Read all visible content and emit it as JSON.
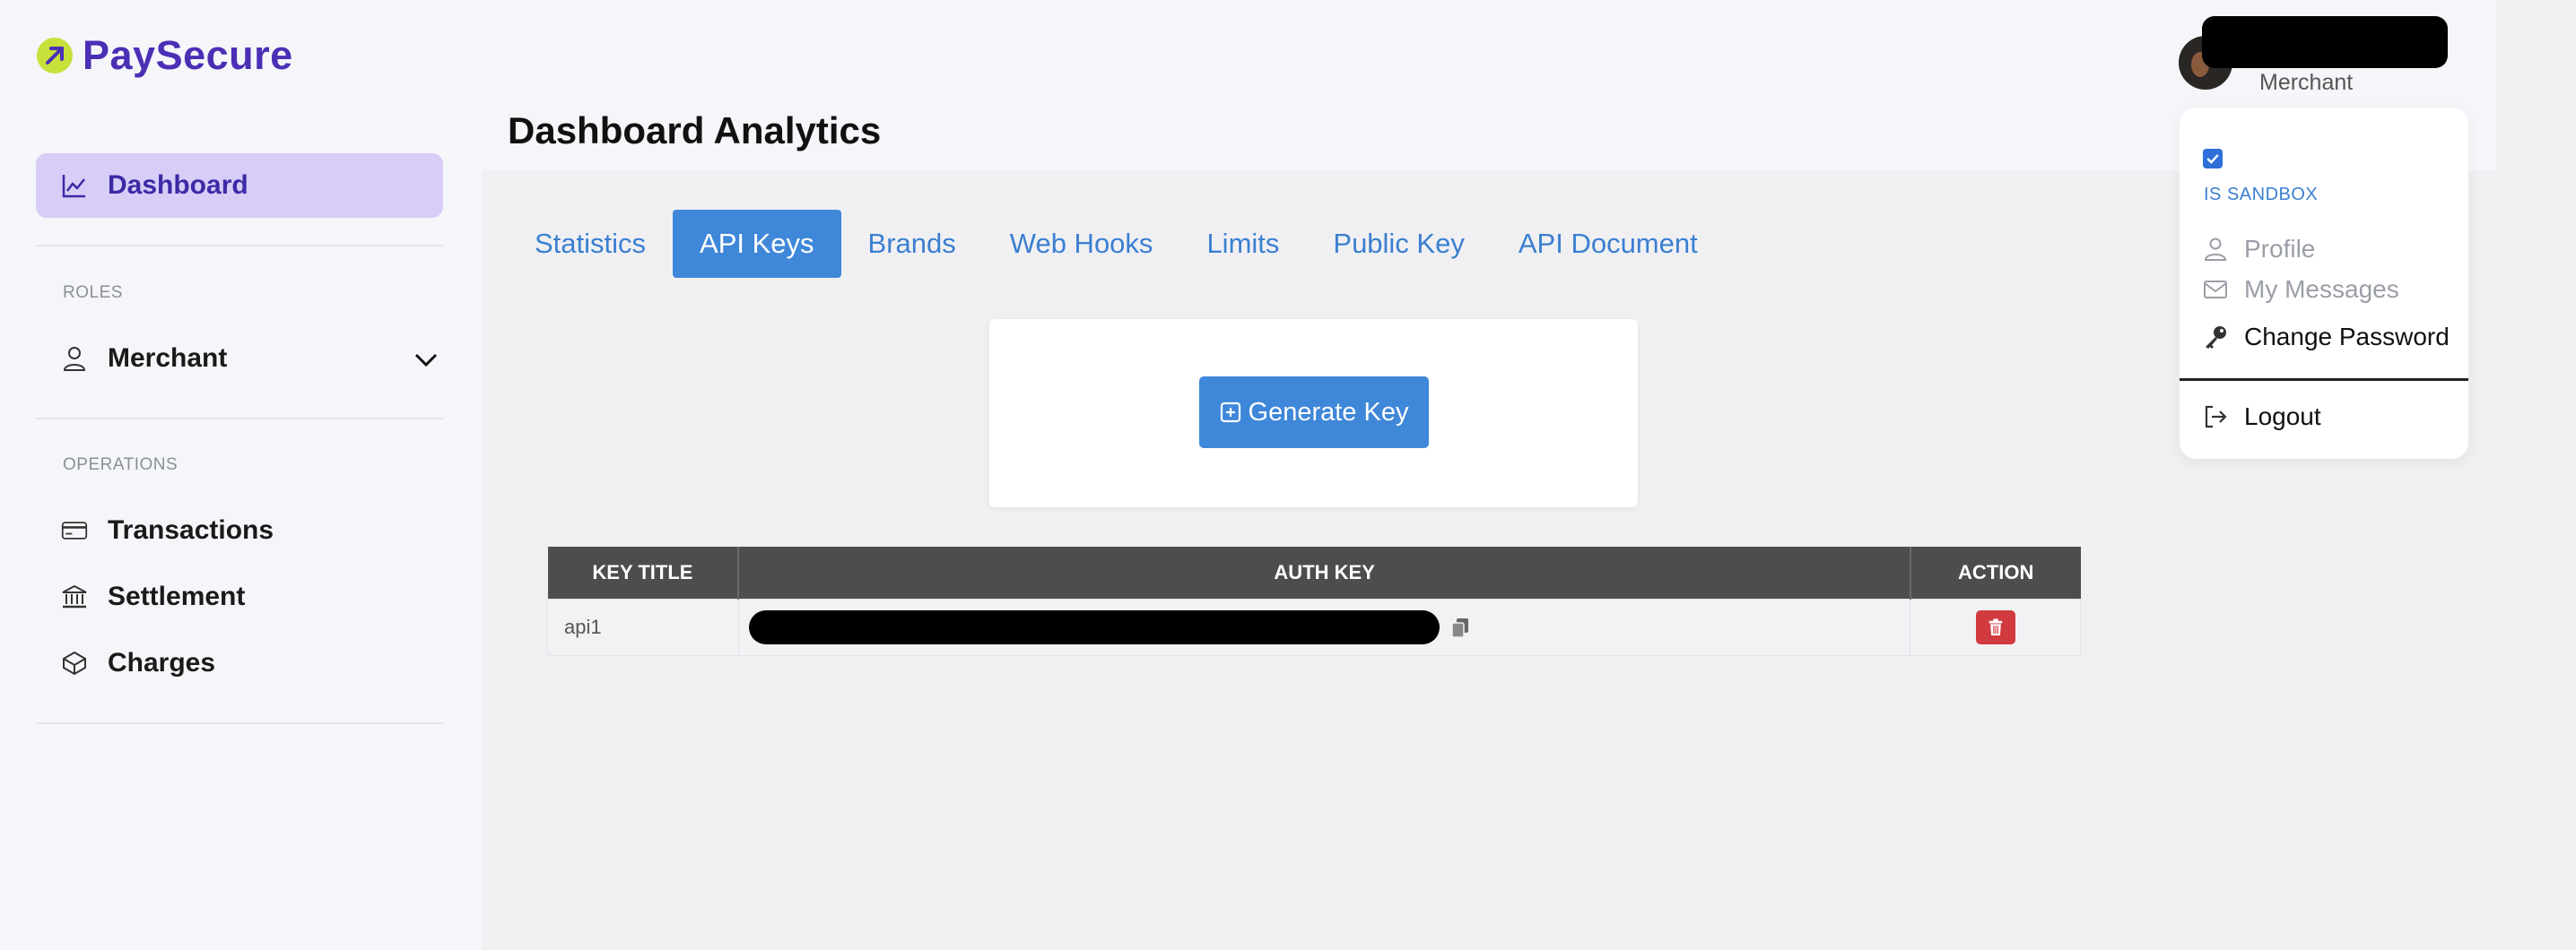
{
  "brand": {
    "name": "PaySecure",
    "colors": {
      "primary": "#4b2fb5",
      "accent": "#c8e03a",
      "button": "#3f87d9",
      "danger": "#d13a3e"
    }
  },
  "sidebar": {
    "dashboard_label": "Dashboard",
    "roles_section": "ROLES",
    "role_item": "Merchant",
    "operations_section": "OPERATIONS",
    "operations": [
      "Transactions",
      "Settlement",
      "Charges"
    ]
  },
  "header": {
    "page_title": "Dashboard Analytics",
    "user_role": "Merchant"
  },
  "tabs": [
    "Statistics",
    "API Keys",
    "Brands",
    "Web Hooks",
    "Limits",
    "Public Key",
    "API Document"
  ],
  "active_tab": "API Keys",
  "generate": {
    "label": "Generate Key"
  },
  "table": {
    "headers": [
      "KEY TITLE",
      "AUTH KEY",
      "ACTION"
    ],
    "rows": [
      {
        "key_title": "api1"
      }
    ]
  },
  "user_menu": {
    "sandbox_label": "IS SANDBOX",
    "sandbox_checked": true,
    "items": [
      "Profile",
      "My Messages",
      "Change Password",
      "Logout"
    ]
  }
}
